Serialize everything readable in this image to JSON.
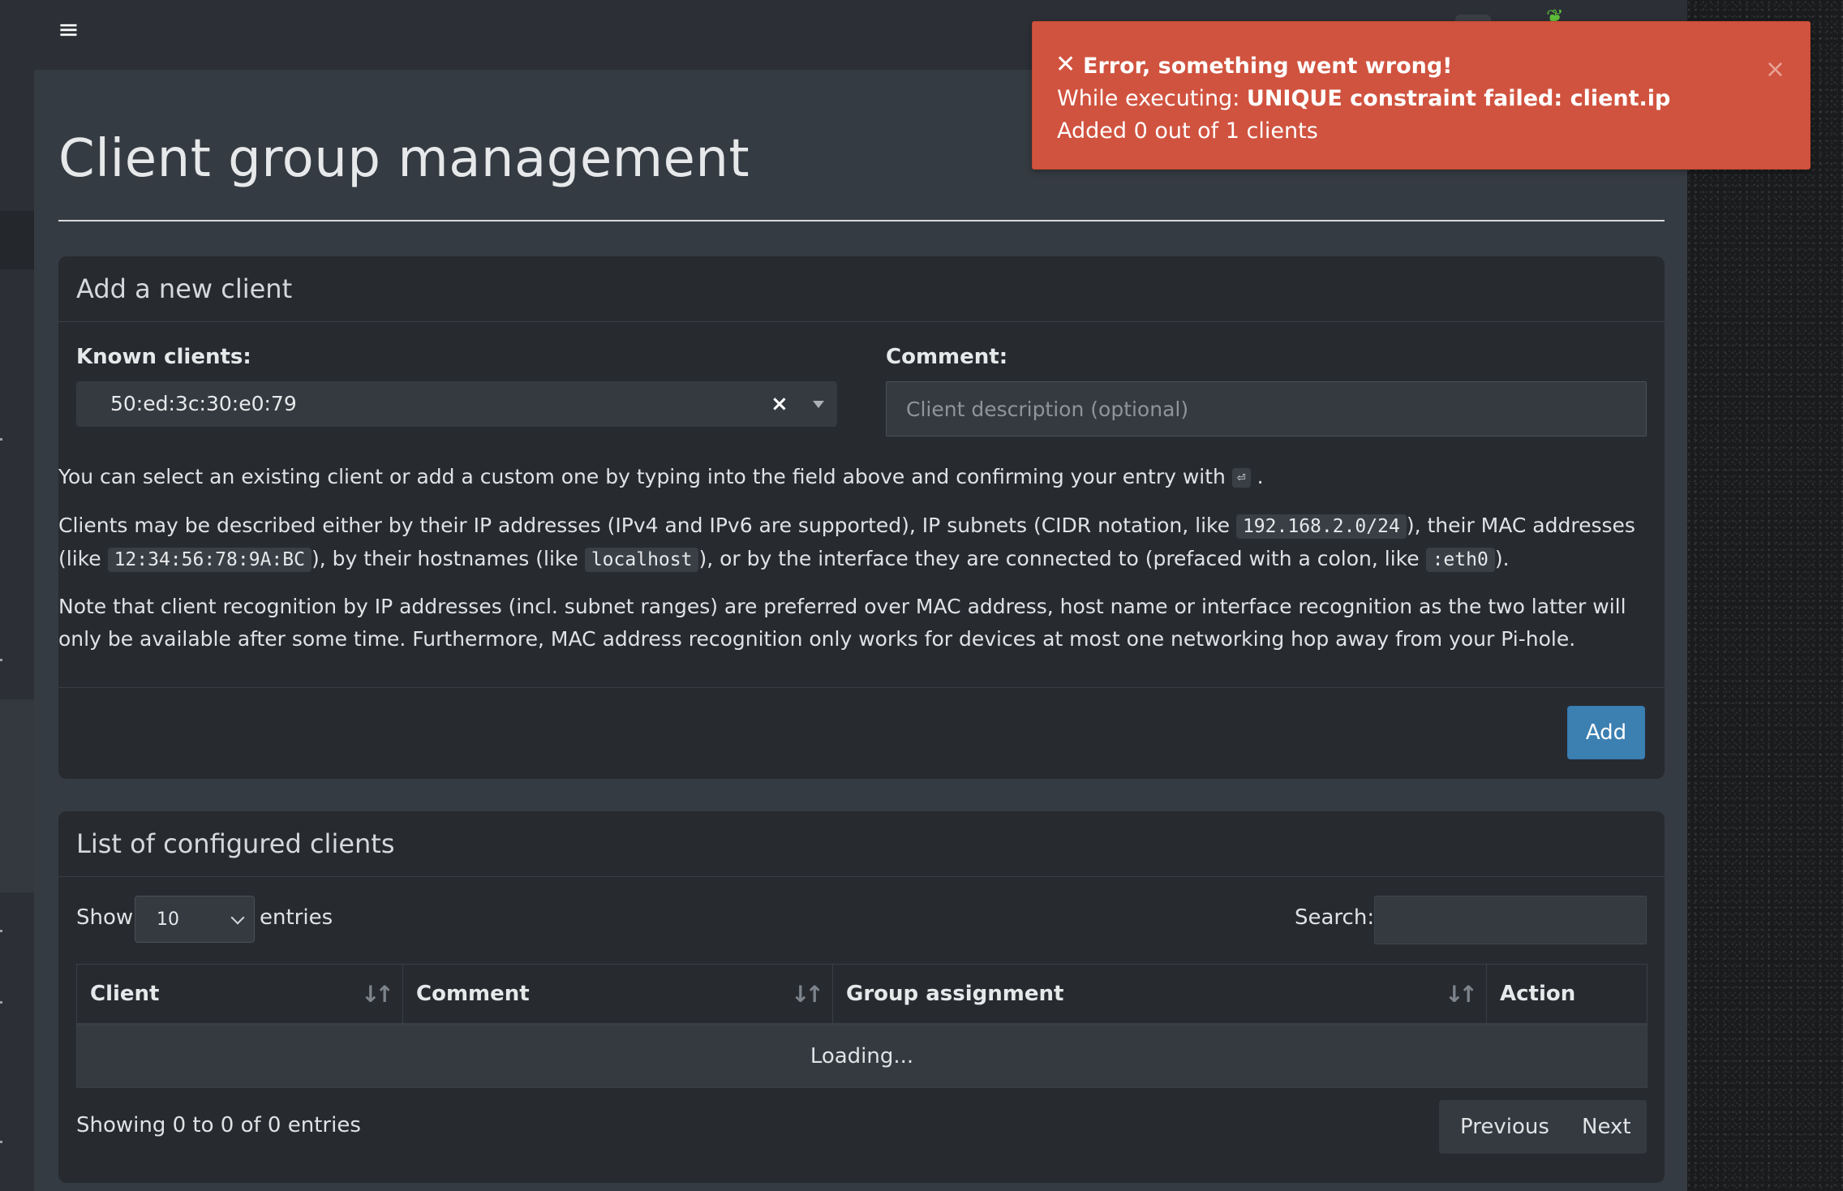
{
  "page": {
    "title": "Client group management"
  },
  "add_box": {
    "title": "Add a new client",
    "known_clients_label": "Known clients:",
    "known_clients_value": "50:ed:3c:30:e0:79",
    "clear_glyph": "×",
    "comment_label": "Comment:",
    "comment_placeholder": "Client description (optional)",
    "help1_text": "You can select an existing client or add a custom one by typing into the field above and confirming your entry with ",
    "help1_key": "⏎",
    "help1_end": ".",
    "help2_a": "Clients may be described either by their IP addresses (IPv4 and IPv6 are supported), IP subnets (CIDR notation, like ",
    "help2_code1": "192.168.2.0/24",
    "help2_b": "), their MAC addresses (like ",
    "help2_code2": "12:34:56:78:9A:BC",
    "help2_c": "), by their hostnames (like ",
    "help2_code3": "localhost",
    "help2_d": "), or by the interface they are connected to (prefaced with a colon, like ",
    "help2_code4": ":eth0",
    "help2_e": ").",
    "help3": "Note that client recognition by IP addresses (incl. subnet ranges) are preferred over MAC address, host name or interface recognition as the two latter will only be available after some time. Furthermore, MAC address recognition only works for devices at most one networking hop away from your Pi-hole.",
    "add_button": "Add"
  },
  "list_box": {
    "title": "List of configured clients",
    "show_label": "Show",
    "entries_value": "10",
    "entries_label": "entries",
    "search_label": "Search:",
    "columns": [
      "Client",
      "Comment",
      "Group assignment",
      "Action"
    ],
    "sort_glyph": "↓↑",
    "loading_text": "Loading...",
    "info_text": "Showing 0 to 0 of 0 entries",
    "prev_label": "Previous",
    "next_label": "Next"
  },
  "toast": {
    "icon": "✕",
    "title": "Error, something went wrong!",
    "line2_prefix": "While executing: ",
    "line2_bold": "UNIQUE constraint failed: client.ip",
    "line3": "Added 0 out of 1 clients",
    "close_glyph": "×"
  },
  "icons": {
    "menu": "hamburger-menu-icon",
    "leaf": "pihole-leaf-icon",
    "error": "error-x-icon",
    "close": "close-icon",
    "sort": "sort-arrows-icon",
    "dropdown": "caret-down-icon",
    "chevron": "chevron-down-icon",
    "enter_key": "enter-key-icon"
  },
  "colors": {
    "toast_bg": "#d0533f",
    "primary_button": "#3c7fb1",
    "content_bg": "#353b42",
    "box_bg": "#272b30",
    "leaf_green": "#5fbf3a"
  }
}
